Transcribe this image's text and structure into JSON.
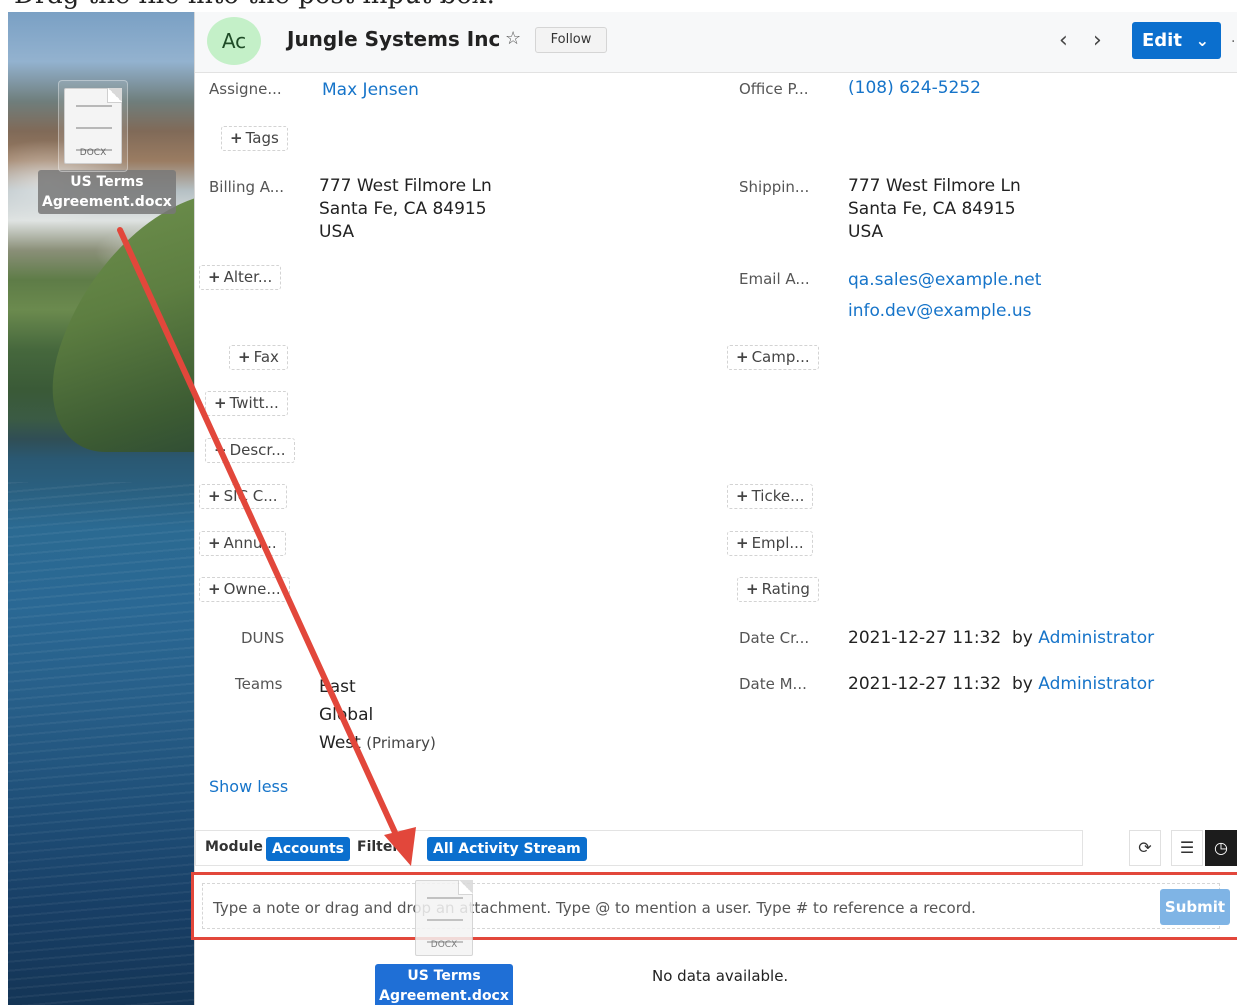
{
  "caption": "Drag the file into the post input box.",
  "desktop": {
    "file": {
      "type": "DOCX",
      "name_line1": "US Terms",
      "name_line2": "Agreement.docx"
    }
  },
  "header": {
    "avatar_text": "Ac",
    "title": "Jungle Systems Inc",
    "follow_label": "Follow",
    "edit_label": "Edit"
  },
  "fields": {
    "assigned_label": "Assigne...",
    "assigned_value": "Max Jensen",
    "office_phone_label": "Office P...",
    "office_phone_value": "(108) 624-5252",
    "tags_btn": "Tags",
    "billing_label": "Billing A...",
    "billing_line1": "777 West Filmore Ln",
    "billing_line2": "Santa Fe, CA 84915",
    "billing_line3": "USA",
    "shipping_label": "Shippin...",
    "shipping_line1": "777 West Filmore Ln",
    "shipping_line2": "Santa Fe, CA 84915",
    "shipping_line3": "USA",
    "alternate_btn": "Alter...",
    "email_label": "Email A...",
    "email_1": "qa.sales@example.net",
    "email_2": "info.dev@example.us",
    "fax_btn": "Fax",
    "campaign_btn": "Camp...",
    "twitter_btn": "Twitt...",
    "description_btn": "Descr...",
    "sic_btn": "SIC C...",
    "ticker_btn": "Ticke...",
    "annual_btn": "Annu...",
    "employees_btn": "Empl...",
    "owner_btn": "Owne...",
    "rating_btn": "Rating",
    "duns_label": "DUNS",
    "date_created_label": "Date Cr...",
    "date_created_value": "2021-12-27 11:32",
    "date_created_by": "by",
    "date_created_user": "Administrator",
    "teams_label": "Teams",
    "team_1": "East",
    "team_2": "Global",
    "team_3": "West",
    "team_3_note": "(Primary)",
    "date_modified_label": "Date M...",
    "date_modified_value": "2021-12-27 11:32",
    "date_modified_by": "by",
    "date_modified_user": "Administrator",
    "show_less": "Show less"
  },
  "activity": {
    "module_label": "Module",
    "module_value": "Accounts",
    "filter_label": "Filter",
    "filter_value": "All Activity Stream",
    "input_placeholder": "Type a note or drag and drop an attachment. Type @ to mention a user. Type # to reference a record.",
    "submit_label": "Submit",
    "empty_text": "No data available."
  },
  "colors": {
    "brand": "#0b6fce",
    "link": "#1674c9",
    "annotation": "#e2473b"
  }
}
